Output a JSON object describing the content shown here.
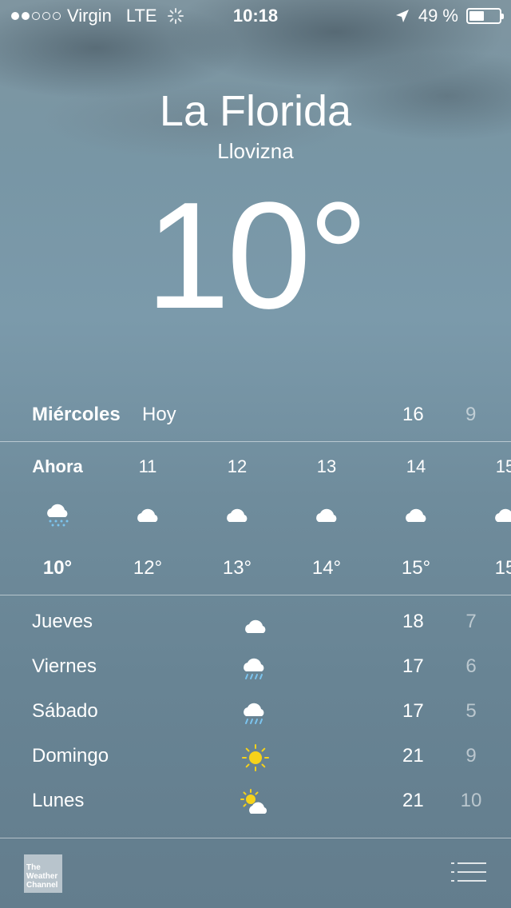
{
  "status_bar": {
    "carrier": "Virgin",
    "network": "LTE",
    "time": "10:18",
    "battery": "49 %",
    "battery_level": 0.49,
    "signal_bars": 2
  },
  "location": {
    "city": "La Florida",
    "condition": "Llovizna",
    "temperature": "10°"
  },
  "today": {
    "day": "Miércoles",
    "label": "Hoy",
    "high": "16",
    "low": "9"
  },
  "hourly": [
    {
      "time": "Ahora",
      "icon": "cloud-drizzle-icon",
      "temp": "10°"
    },
    {
      "time": "11",
      "icon": "cloud-icon",
      "temp": "12°"
    },
    {
      "time": "12",
      "icon": "cloud-icon",
      "temp": "13°"
    },
    {
      "time": "13",
      "icon": "cloud-icon",
      "temp": "14°"
    },
    {
      "time": "14",
      "icon": "cloud-icon",
      "temp": "15°"
    },
    {
      "time": "15",
      "icon": "cloud-icon",
      "temp": "15"
    }
  ],
  "daily": [
    {
      "day": "Jueves",
      "icon": "cloud-icon",
      "high": "18",
      "low": "7"
    },
    {
      "day": "Viernes",
      "icon": "cloud-rain-icon",
      "high": "17",
      "low": "6"
    },
    {
      "day": "Sábado",
      "icon": "cloud-rain-icon",
      "high": "17",
      "low": "5"
    },
    {
      "day": "Domingo",
      "icon": "sun-icon",
      "high": "21",
      "low": "9"
    },
    {
      "day": "Lunes",
      "icon": "partly-cloudy-icon",
      "high": "21",
      "low": "10"
    }
  ],
  "footer": {
    "logo_line1": "The",
    "logo_line2": "Weather",
    "logo_line3": "Channel"
  },
  "colors": {
    "rain_blue": "#7cc4ee",
    "sun_yellow": "#f6d21a"
  }
}
